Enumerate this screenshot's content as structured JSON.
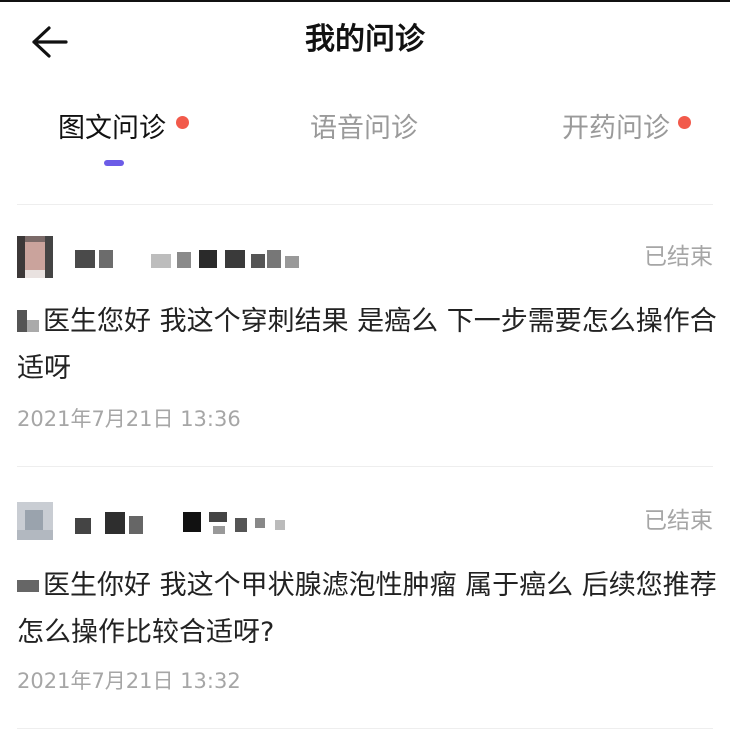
{
  "header": {
    "title": "我的问诊",
    "back_icon": "arrow-left-icon"
  },
  "tabs": [
    {
      "label": "图文问诊",
      "active": true,
      "has_badge": true
    },
    {
      "label": "语音问诊",
      "active": false,
      "has_badge": false
    },
    {
      "label": "开药问诊",
      "active": false,
      "has_badge": true
    }
  ],
  "colors": {
    "accent": "#6c5ce7",
    "badge": "#f25a4b",
    "muted_text": "#a6a6a6"
  },
  "consultations": [
    {
      "status": "已结束",
      "message": "医生您好 我这个穿刺结果 是癌么 下一步需要怎么操作合适呀",
      "time": "2021年7月21日 13:36"
    },
    {
      "status": "已结束",
      "message": "医生你好 我这个甲状腺滤泡性肿瘤 属于癌么 后续您推荐怎么操作比较合适呀?",
      "time": "2021年7月21日 13:32"
    }
  ]
}
